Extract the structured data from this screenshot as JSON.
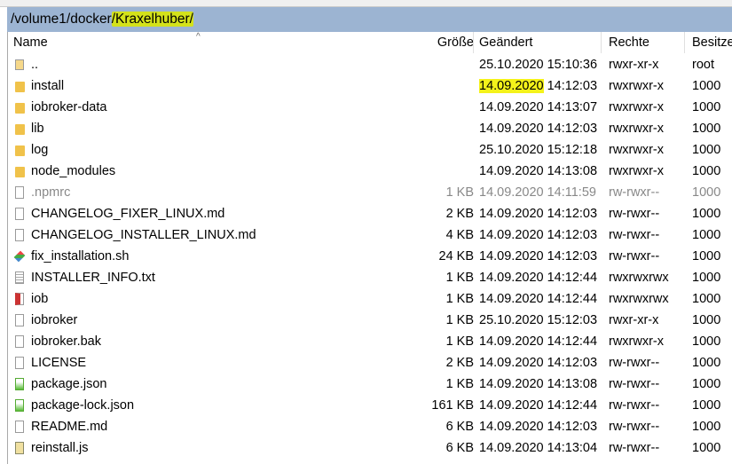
{
  "path": {
    "prefix": "/volume1/docker",
    "highlight": "/Kraxelhuber/"
  },
  "columns": {
    "name": "Name",
    "size": "Größe",
    "date": "Geändert",
    "perm": "Rechte",
    "owner": "Besitze"
  },
  "highlight_color": "#d4e21a",
  "files": [
    {
      "name": "..",
      "size": "",
      "date": "25.10.2020 15:10:36",
      "perm": "rwxr-xr-x",
      "owner": "root",
      "icon": "parent-dir-icon"
    },
    {
      "name": "install",
      "size": "",
      "date": "14.09.2020",
      "time": " 14:12:03",
      "perm": "rwxrwxr-x",
      "owner": "1000",
      "icon": "folder-icon",
      "date_highlight": true
    },
    {
      "name": "iobroker-data",
      "size": "",
      "date": "14.09.2020 14:13:07",
      "perm": "rwxrwxr-x",
      "owner": "1000",
      "icon": "folder-icon"
    },
    {
      "name": "lib",
      "size": "",
      "date": "14.09.2020 14:12:03",
      "perm": "rwxrwxr-x",
      "owner": "1000",
      "icon": "folder-icon"
    },
    {
      "name": "log",
      "size": "",
      "date": "25.10.2020 15:12:18",
      "perm": "rwxrwxr-x",
      "owner": "1000",
      "icon": "folder-icon"
    },
    {
      "name": "node_modules",
      "size": "",
      "date": "14.09.2020 14:13:08",
      "perm": "rwxrwxr-x",
      "owner": "1000",
      "icon": "folder-icon"
    },
    {
      "name": ".npmrc",
      "size": "1 KB",
      "date": "14.09.2020 14:11:59",
      "perm": "rw-rwxr--",
      "owner": "1000",
      "icon": "file-icon",
      "hidden": true
    },
    {
      "name": "CHANGELOG_FIXER_LINUX.md",
      "size": "2 KB",
      "date": "14.09.2020 14:12:03",
      "perm": "rw-rwxr--",
      "owner": "1000",
      "icon": "file-icon"
    },
    {
      "name": "CHANGELOG_INSTALLER_LINUX.md",
      "size": "4 KB",
      "date": "14.09.2020 14:12:03",
      "perm": "rw-rwxr--",
      "owner": "1000",
      "icon": "file-icon"
    },
    {
      "name": "fix_installation.sh",
      "size": "24 KB",
      "date": "14.09.2020 14:12:03",
      "perm": "rw-rwxr--",
      "owner": "1000",
      "icon": "script-icon"
    },
    {
      "name": "INSTALLER_INFO.txt",
      "size": "1 KB",
      "date": "14.09.2020 14:12:44",
      "perm": "rwxrwxrwx",
      "owner": "1000",
      "icon": "text-file-icon"
    },
    {
      "name": "iob",
      "size": "1 KB",
      "date": "14.09.2020 14:12:44",
      "perm": "rwxrwxrwx",
      "owner": "1000",
      "icon": "link-file-icon"
    },
    {
      "name": "iobroker",
      "size": "1 KB",
      "date": "25.10.2020 15:12:03",
      "perm": "rwxr-xr-x",
      "owner": "1000",
      "icon": "file-icon"
    },
    {
      "name": "iobroker.bak",
      "size": "1 KB",
      "date": "14.09.2020 14:12:44",
      "perm": "rwxrwxr-x",
      "owner": "1000",
      "icon": "file-icon"
    },
    {
      "name": "LICENSE",
      "size": "2 KB",
      "date": "14.09.2020 14:12:03",
      "perm": "rw-rwxr--",
      "owner": "1000",
      "icon": "file-icon"
    },
    {
      "name": "package.json",
      "size": "1 KB",
      "date": "14.09.2020 14:13:08",
      "perm": "rw-rwxr--",
      "owner": "1000",
      "icon": "json-file-icon"
    },
    {
      "name": "package-lock.json",
      "size": "161 KB",
      "date": "14.09.2020 14:12:44",
      "perm": "rw-rwxr--",
      "owner": "1000",
      "icon": "json-file-icon"
    },
    {
      "name": "README.md",
      "size": "6 KB",
      "date": "14.09.2020 14:12:03",
      "perm": "rw-rwxr--",
      "owner": "1000",
      "icon": "file-icon"
    },
    {
      "name": "reinstall.js",
      "size": "6 KB",
      "date": "14.09.2020 14:13:04",
      "perm": "rw-rwxr--",
      "owner": "1000",
      "icon": "js-file-icon"
    }
  ]
}
